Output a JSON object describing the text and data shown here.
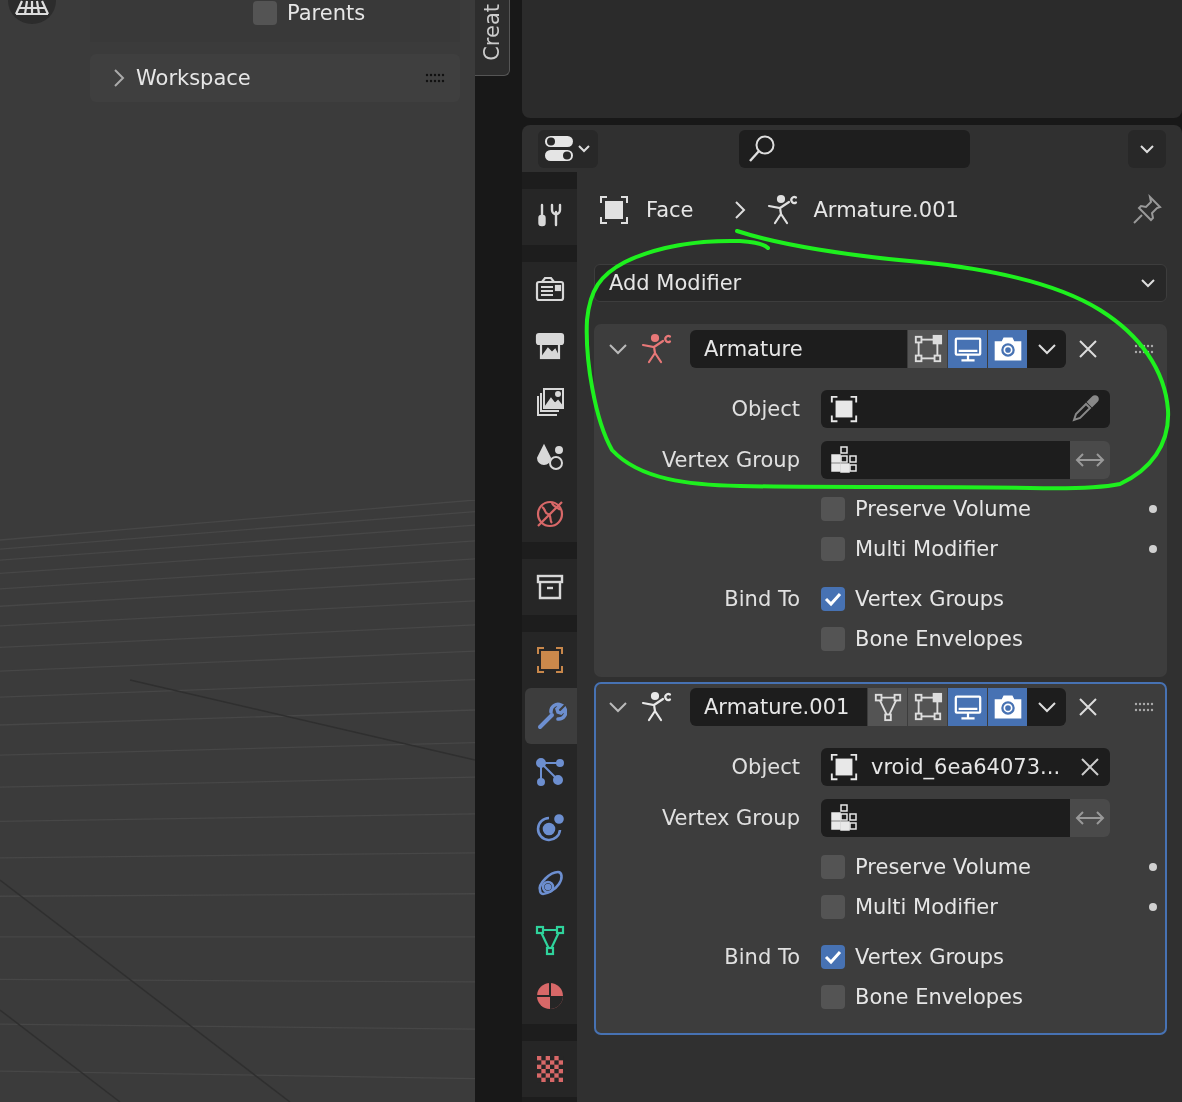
{
  "viewport": {
    "parents": {
      "label": "Parents",
      "checked": false
    },
    "workspace": {
      "label": "Workspace",
      "expanded": false
    },
    "tab": {
      "label": "Creat"
    }
  },
  "properties": {
    "sidebar_groups": [
      [
        {
          "kind": "tool",
          "selected": false
        }
      ],
      [
        {
          "kind": "render",
          "selected": false
        },
        {
          "kind": "output",
          "selected": false
        },
        {
          "kind": "view_layer",
          "selected": false
        },
        {
          "kind": "scene",
          "selected": false
        },
        {
          "kind": "world",
          "selected": false
        }
      ],
      [
        {
          "kind": "collection",
          "selected": false
        }
      ],
      [
        {
          "kind": "object",
          "selected": false
        },
        {
          "kind": "modifiers",
          "selected": true
        },
        {
          "kind": "particles",
          "selected": false
        },
        {
          "kind": "physics",
          "selected": false
        },
        {
          "kind": "constraints",
          "selected": false
        },
        {
          "kind": "data",
          "selected": false
        },
        {
          "kind": "material",
          "selected": false
        }
      ],
      [
        {
          "kind": "texture",
          "selected": false
        }
      ]
    ],
    "breadcrumb": [
      {
        "kind": "object",
        "label": "Face"
      },
      {
        "kind": "armature",
        "label": "Armature.001"
      }
    ],
    "add_modifier": {
      "label": "Add Modifier"
    },
    "modifiers": [
      {
        "name": "Armature",
        "selected": false,
        "expanded": true,
        "valid": false,
        "toggles": [
          {
            "kind": "editmode",
            "on": false
          },
          {
            "kind": "viewport",
            "on": true
          },
          {
            "kind": "render",
            "on": true
          }
        ],
        "object": {
          "label": "Object"
        },
        "vertex_group": {
          "label": "Vertex Group",
          "invert": false
        },
        "options": [
          {
            "label": "Preserve Volume",
            "checked": false
          },
          {
            "label": "Multi Modifier",
            "checked": false
          }
        ],
        "bind_to": {
          "label": "Bind To",
          "options": [
            {
              "label": "Vertex Groups",
              "checked": true
            },
            {
              "label": "Bone Envelopes",
              "checked": false
            }
          ]
        }
      },
      {
        "name": "Armature.001",
        "selected": true,
        "expanded": true,
        "valid": true,
        "toggles": [
          {
            "kind": "on_cage",
            "on": false
          },
          {
            "kind": "editmode",
            "on": false
          },
          {
            "kind": "viewport",
            "on": true
          },
          {
            "kind": "render",
            "on": true
          }
        ],
        "object": {
          "label": "Object",
          "value": "vroid_6ea64073..."
        },
        "vertex_group": {
          "label": "Vertex Group",
          "invert": false
        },
        "options": [
          {
            "label": "Preserve Volume",
            "checked": false
          },
          {
            "label": "Multi Modifier",
            "checked": false
          }
        ],
        "bind_to": {
          "label": "Bind To",
          "options": [
            {
              "label": "Vertex Groups",
              "checked": true
            },
            {
              "label": "Bone Envelopes",
              "checked": false
            }
          ]
        }
      }
    ]
  }
}
